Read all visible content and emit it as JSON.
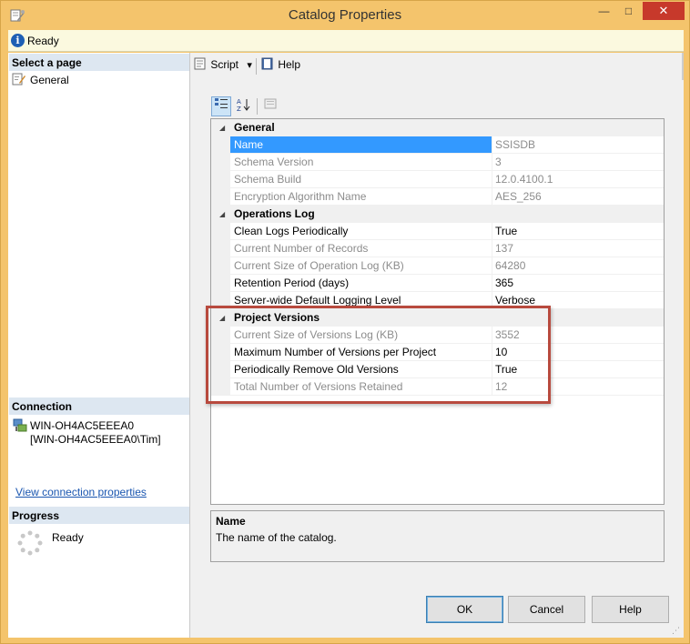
{
  "window": {
    "title": "Catalog Properties",
    "minimize": "—",
    "maximize": "□",
    "close": "✕"
  },
  "status": {
    "text": "Ready",
    "icon": "info-icon"
  },
  "left_panel": {
    "select_page_header": "Select a page",
    "pages": [
      {
        "label": "General",
        "icon": "wrench-page-icon"
      }
    ],
    "connection_header": "Connection",
    "connection_server": "WIN-OH4AC5EEEA0",
    "connection_user": "[WIN-OH4AC5EEEA0\\Tim]",
    "view_connection_link": "View connection properties",
    "progress_header": "Progress",
    "progress_text": "Ready"
  },
  "toolbar": {
    "script_label": "Script",
    "script_dropdown": "▾",
    "help_label": "Help"
  },
  "property_grid": {
    "categories": [
      {
        "label": "General",
        "expander": "◢",
        "properties": [
          {
            "name": "Name",
            "value": "SSISDB",
            "readonly": true,
            "selected": true
          },
          {
            "name": "Schema Version",
            "value": "3",
            "readonly": true
          },
          {
            "name": "Schema Build",
            "value": "12.0.4100.1",
            "readonly": true
          },
          {
            "name": "Encryption Algorithm Name",
            "value": "AES_256",
            "readonly": true
          }
        ]
      },
      {
        "label": "Operations Log",
        "expander": "◢",
        "properties": [
          {
            "name": "Clean Logs Periodically",
            "value": "True",
            "readonly": false
          },
          {
            "name": "Current Number of Records",
            "value": "137",
            "readonly": true
          },
          {
            "name": "Current Size of Operation Log (KB)",
            "value": "64280",
            "readonly": true
          },
          {
            "name": "Retention Period (days)",
            "value": "365",
            "readonly": false
          },
          {
            "name": "Server-wide Default Logging Level",
            "value": "Verbose",
            "readonly": false
          }
        ]
      },
      {
        "label": "Project Versions",
        "expander": "◢",
        "properties": [
          {
            "name": "Current Size of Versions Log (KB)",
            "value": "3552",
            "readonly": true
          },
          {
            "name": "Maximum Number of Versions per Project",
            "value": "10",
            "readonly": false
          },
          {
            "name": "Periodically Remove Old Versions",
            "value": "True",
            "readonly": false
          },
          {
            "name": "Total Number of Versions Retained",
            "value": "12",
            "readonly": true
          }
        ]
      }
    ]
  },
  "description": {
    "title": "Name",
    "text": "The name of the catalog."
  },
  "buttons": {
    "ok": "OK",
    "cancel": "Cancel",
    "help": "Help"
  },
  "colors": {
    "title_bar": "#f4c46c",
    "close_button": "#c7392b",
    "selection": "#3399ff",
    "highlight_box": "#b84a3e",
    "link": "#1a56b0"
  }
}
